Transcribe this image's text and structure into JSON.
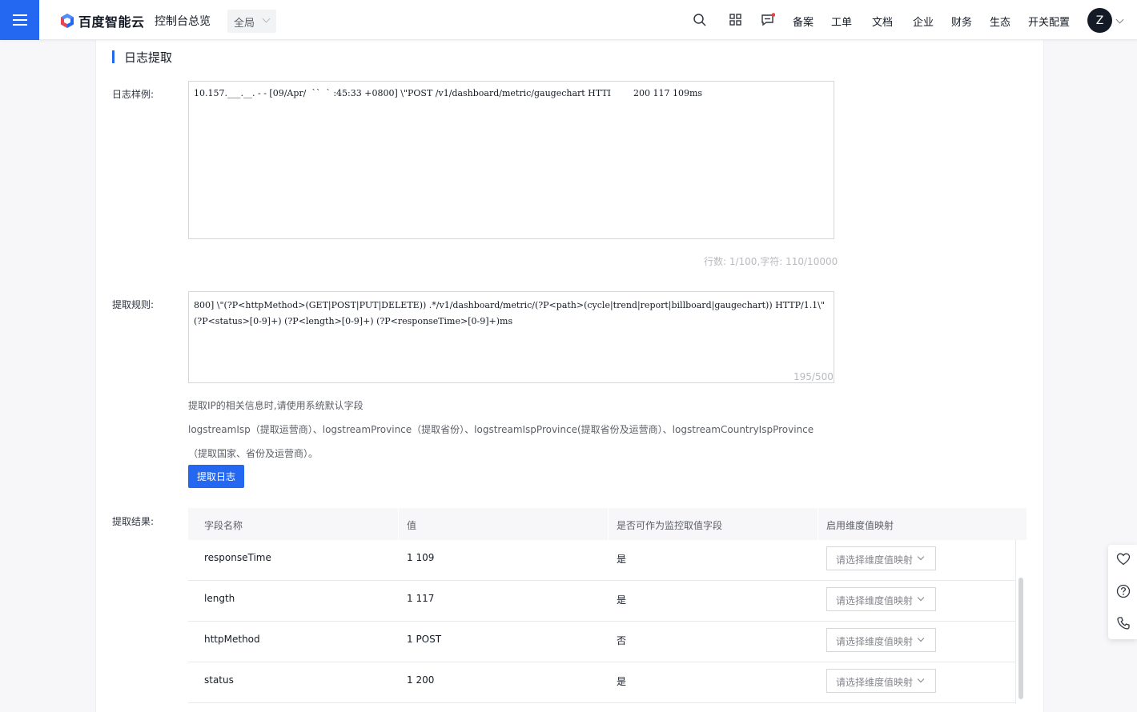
{
  "brand": {
    "name": "百度智能云"
  },
  "header": {
    "console_label": "控制台总览",
    "region": "全局",
    "nav": [
      "备案",
      "工单",
      "文档",
      "企业",
      "财务",
      "生态",
      "开关配置"
    ],
    "avatar_letter": "Z",
    "icons": [
      "search-icon",
      "apps-icon",
      "message-icon"
    ],
    "accent_color": "#2468f2",
    "notification_dot_color": "#f33e3e"
  },
  "section": {
    "title": "日志提取"
  },
  "sample": {
    "label": "日志样例:",
    "text": "10.157.___.__. - - [09/Apr/  ``  ` :45:33 +0800] \\\"POST /v1/dashboard/metric/gaugechart HTTI        200 117 109ms",
    "counter": "行数: 1/100,字符: 110/10000"
  },
  "rule": {
    "label": "提取规则:",
    "text": "800] \\\"(?P<httpMethod>(GET|POST|PUT|DELETE)) .*/v1/dashboard/metric/(?P<path>(cycle|trend|report|billboard|gaugechart)) HTTP/1.1\\\" (?P<status>[0-9]+) (?P<length>[0-9]+) (?P<responseTime>[0-9]+)ms",
    "counter": "195/500"
  },
  "hints": {
    "line1": "提取IP的相关信息时,请使用系统默认字段",
    "line2": "logstreamIsp（提取运营商）、logstreamProvince（提取省份）、logstreamIspProvince(提取省份及运营商）、logstreamCountryIspProvince",
    "line3": "（提取国家、省份及运营商）。"
  },
  "extract_button": "提取日志",
  "result": {
    "label": "提取结果:",
    "columns": [
      "字段名称",
      "值",
      "是否可作为监控取值字段",
      "启用维度值映射"
    ],
    "rows": [
      {
        "field": "responseTime",
        "value": "1 109",
        "monitorable": "是",
        "mapping_placeholder": "请选择维度值映射"
      },
      {
        "field": "length",
        "value": "1 117",
        "monitorable": "是",
        "mapping_placeholder": "请选择维度值映射"
      },
      {
        "field": "httpMethod",
        "value": "1 POST",
        "monitorable": "否",
        "mapping_placeholder": "请选择维度值映射"
      },
      {
        "field": "status",
        "value": "1 200",
        "monitorable": "是",
        "mapping_placeholder": "请选择维度值映射"
      }
    ]
  },
  "float_tools": [
    "heart-icon",
    "help-icon",
    "phone-icon"
  ]
}
